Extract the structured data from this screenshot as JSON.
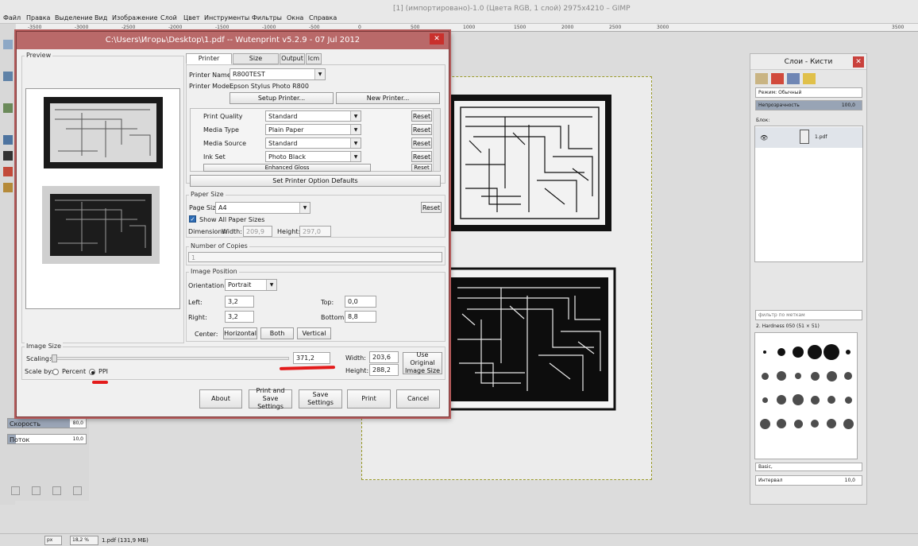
{
  "gimp": {
    "title": "[1] (импортировано)-1.0 (Цвета RGB, 1 слой) 2975x4210 – GIMP",
    "menu": [
      "Файл",
      "Правка",
      "Выделение",
      "Вид",
      "Изображение",
      "Слой",
      "Цвет",
      "Инструменты",
      "Фильтры",
      "Окна",
      "Справка"
    ],
    "ruler_ticks": [
      "-3500",
      "-3000",
      "-2500",
      "-2000",
      "-1500",
      "-1000",
      "-500",
      "0",
      "500",
      "1000",
      "1500",
      "2000",
      "2500",
      "3000",
      "3500"
    ],
    "tool_options": {
      "speed_label": "Скорость",
      "speed_value": "80,0",
      "speed_fraction": 0.8,
      "flow_label": "Поток",
      "flow_value": "10,0",
      "flow_fraction": 0.1
    },
    "status": {
      "unit": "px",
      "zoom": "18,2 %",
      "file": "1.pdf (131,9 МБ)"
    }
  },
  "layers_panel": {
    "title": "Слои - Кисти",
    "mode_label": "Режим:",
    "mode_value": "Обычный",
    "opacity_label": "Непрозрачность",
    "opacity_value": "100,0",
    "lock_label": "Блок:",
    "layer_name": "1.pdf",
    "brush_filter_placeholder": "фильтр по меткам",
    "brush_name": "2. Hardness 050 (51 × 51)",
    "brush_preset": "Basic,",
    "spacing_label": "Интервал",
    "spacing_value": "10,0"
  },
  "dialog": {
    "title": "C:\\Users\\Игорь\\Desktop\\1.pdf -- Wutenprint v5.2.9 - 07 Jul 2012",
    "preview_label": "Preview",
    "tabs": [
      "Printer Settings",
      "Size Units:mm",
      "Output",
      "lcm"
    ],
    "printer_name_label": "Printer Name:",
    "printer_name_value": "R800TEST",
    "printer_model_label": "Printer Model:",
    "printer_model_value": "Epson Stylus Photo R800",
    "setup_printer_btn": "Setup Printer...",
    "new_printer_btn": "New Printer...",
    "options": [
      {
        "label": "Print Quality",
        "value": "Standard",
        "reset": "Reset"
      },
      {
        "label": "Media Type",
        "value": "Plain Paper",
        "reset": "Reset"
      },
      {
        "label": "Media Source",
        "value": "Standard",
        "reset": "Reset"
      },
      {
        "label": "Ink Set",
        "value": "Photo Black",
        "reset": "Reset"
      },
      {
        "label": "Enhanced Gloss",
        "value": "",
        "reset": "Reset"
      }
    ],
    "set_defaults_btn": "Set Printer Option Defaults",
    "paper_size_group": "Paper Size",
    "page_size_label": "Page Size:",
    "page_size_value": "A4",
    "paper_reset": "Reset",
    "show_all_label": "Show All Paper Sizes",
    "dimensions_label": "Dimensions:",
    "width_label": "Width:",
    "width_value": "209,9",
    "height_label": "Height:",
    "height_value": "297,0",
    "copies_group": "Number of Copies",
    "copies_value": "1",
    "image_position_group": "Image Position",
    "orientation_label": "Orientation:",
    "orientation_value": "Portrait",
    "left_label": "Left:",
    "left_value": "3,2",
    "top_label": "Top:",
    "top_value": "0,0",
    "right_label": "Right:",
    "right_value": "3,2",
    "bottom_label": "Bottom:",
    "bottom_value": "8,8",
    "center_label": "Center:",
    "center_buttons": [
      "Horizontal",
      "Both",
      "Vertical"
    ],
    "image_size_group": "Image Size",
    "scaling_label": "Scaling:",
    "scaling_value": "371,2",
    "scale_by_label": "Scale by:",
    "percent_label": "Percent",
    "ppi_label": "PPI",
    "img_width_label": "Width:",
    "img_width_value": "203,6",
    "img_height_label": "Height:",
    "img_height_value": "288,2",
    "use_original_btn": "Use Original Image Size",
    "bottom_buttons": [
      "About",
      "Print and Save Settings",
      "Save Settings",
      "Print",
      "Cancel"
    ]
  },
  "colors": {
    "dialog_titlebar": "#b96969",
    "annotation_red": "#e31b1b",
    "canvas_guide": "#9a9a2a"
  }
}
